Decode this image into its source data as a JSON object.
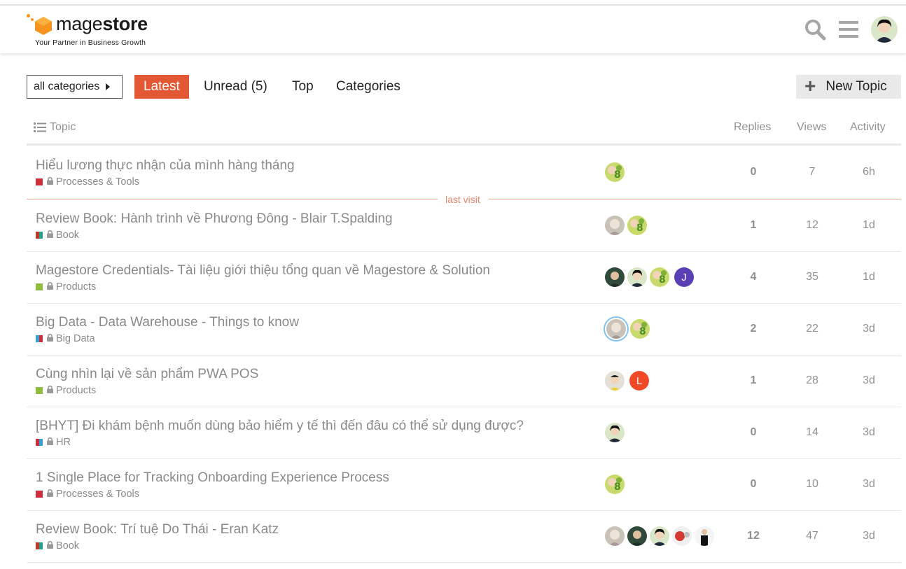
{
  "logo": {
    "word_light": "mage",
    "word_bold": "store",
    "tagline": "Your Partner in Business Growth",
    "color": "#f7941d"
  },
  "header": {
    "search_icon": "search-icon",
    "menu_icon": "hamburger-menu-icon"
  },
  "nav": {
    "category_dropdown": "all categories",
    "latest": "Latest",
    "unread": "Unread (5)",
    "top": "Top",
    "categories": "Categories",
    "new_topic": "New Topic",
    "accent": "#e45735"
  },
  "table": {
    "col_topic": "Topic",
    "col_replies": "Replies",
    "col_views": "Views",
    "col_activity": "Activity"
  },
  "last_visit": "last visit",
  "topics": [
    {
      "title": "Hiểu lương thực nhận của mình hàng tháng",
      "category": "Processes & Tools",
      "c1": "#d02d3b",
      "c2": "#d02d3b",
      "replies": "0",
      "views": "7",
      "activity": "6h",
      "posters": [
        {
          "type": "green"
        }
      ]
    },
    {
      "title": "Review Book: Hành trình về Phương Đông - Blair T.Spalding",
      "category": "Book",
      "c1": "#c0392b",
      "c2": "#27a08a",
      "replies": "1",
      "views": "12",
      "activity": "1d",
      "posters": [
        {
          "type": "grey"
        },
        {
          "type": "green"
        }
      ]
    },
    {
      "title": "Magestore Credentials- Tài liệu giới thiệu tổng quan về Magestore & Solution",
      "category": "Products",
      "c1": "#8dbf3f",
      "c2": "#8dbf3f",
      "replies": "4",
      "views": "35",
      "activity": "1d",
      "posters": [
        {
          "type": "dark"
        },
        {
          "type": "face"
        },
        {
          "type": "green"
        },
        {
          "type": "letter",
          "letter": "J",
          "color": "#5b3fb4"
        }
      ]
    },
    {
      "title": "Big Data - Data Warehouse - Things to know",
      "category": "Big Data",
      "c1": "#3aa0d8",
      "c2": "#d02d3b",
      "replies": "2",
      "views": "22",
      "activity": "3d",
      "posters": [
        {
          "type": "grey",
          "ring": true
        },
        {
          "type": "green"
        }
      ]
    },
    {
      "title": "Cùng nhìn lại về sản phẩm PWA POS",
      "category": "Products",
      "c1": "#8dbf3f",
      "c2": "#8dbf3f",
      "replies": "1",
      "views": "28",
      "activity": "3d",
      "posters": [
        {
          "type": "kid"
        },
        {
          "type": "letter",
          "letter": "L",
          "color": "#ef4a25"
        }
      ]
    },
    {
      "title": "[BHYT] Đi khám bệnh muốn dùng bảo hiểm y tế thì đến đâu có thể sử dụng được?",
      "category": "HR",
      "c1": "#d02d3b",
      "c2": "#3aa0d8",
      "replies": "0",
      "views": "14",
      "activity": "3d",
      "posters": [
        {
          "type": "face"
        }
      ]
    },
    {
      "title": "1 Single Place for Tracking Onboarding Experience Process",
      "category": "Processes & Tools",
      "c1": "#d02d3b",
      "c2": "#d02d3b",
      "replies": "0",
      "views": "10",
      "activity": "3d",
      "posters": [
        {
          "type": "green"
        }
      ]
    },
    {
      "title": "Review Book: Trí tuệ Do Thái - Eran Katz",
      "category": "Book",
      "c1": "#c0392b",
      "c2": "#27a08a",
      "replies": "12",
      "views": "47",
      "activity": "3d",
      "posters": [
        {
          "type": "grey"
        },
        {
          "type": "dark"
        },
        {
          "type": "face"
        },
        {
          "type": "red"
        },
        {
          "type": "black"
        }
      ]
    }
  ]
}
